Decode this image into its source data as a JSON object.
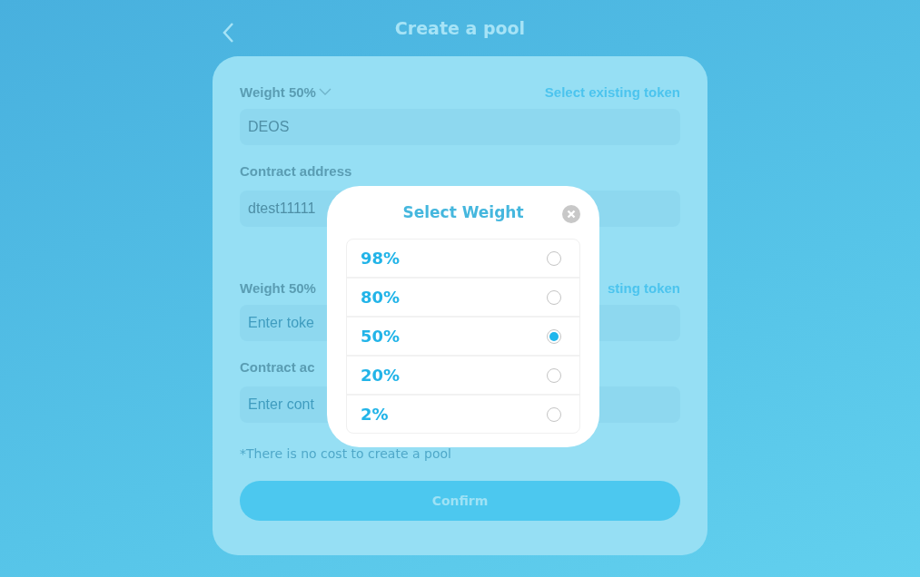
{
  "header": {
    "title": "Create a pool"
  },
  "sections": [
    {
      "weight_label": "Weight 50%",
      "has_dropdown": true,
      "link": "Select existing token",
      "token": {
        "value": "DEOS"
      },
      "contract_label": "Contract address",
      "contract": {
        "value": "dtest11111"
      }
    },
    {
      "weight_label": "Weight 50%",
      "has_dropdown": false,
      "link": "sting token",
      "token": {
        "placeholder": "Enter toke"
      },
      "contract_label": "Contract ac",
      "contract": {
        "placeholder": "Enter cont"
      }
    }
  ],
  "note": "*There is no cost to create a pool",
  "confirm_button": "Confirm",
  "modal": {
    "title": "Select Weight",
    "options": [
      {
        "label": "98%",
        "selected": false
      },
      {
        "label": "80%",
        "selected": false
      },
      {
        "label": "50%",
        "selected": true
      },
      {
        "label": "20%",
        "selected": false
      },
      {
        "label": "2%",
        "selected": false
      }
    ]
  }
}
